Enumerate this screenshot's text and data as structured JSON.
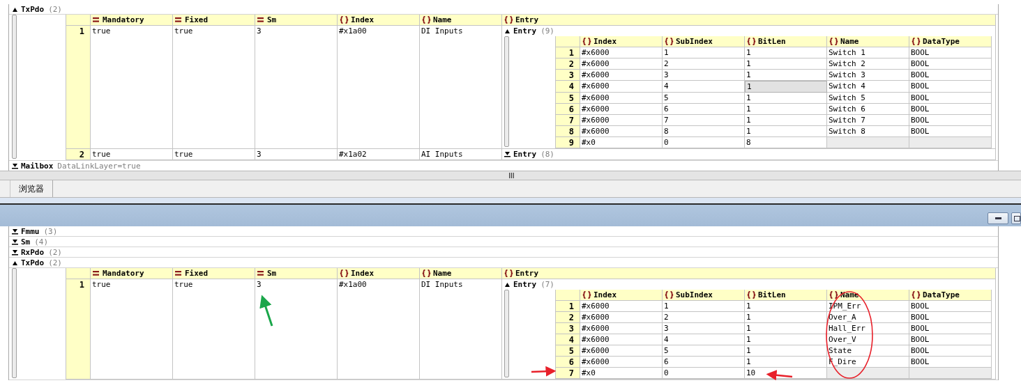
{
  "panes": [
    {
      "group": {
        "label": "TxPdo",
        "count": "(2)",
        "expanded": true
      },
      "table": {
        "columns": [
          {
            "kind": "attribute",
            "label": "Mandatory"
          },
          {
            "kind": "attribute",
            "label": "Fixed"
          },
          {
            "kind": "attribute",
            "label": "Sm"
          },
          {
            "kind": "element",
            "label": "Index"
          },
          {
            "kind": "element",
            "label": "Name"
          },
          {
            "kind": "element",
            "label": "Entry"
          }
        ],
        "rows": [
          {
            "num": "1",
            "cells": [
              "true",
              "true",
              "3",
              "#x1a00",
              "DI Inputs"
            ],
            "entry": {
              "label": "Entry",
              "count": "(9)",
              "expanded": true,
              "columns": [
                {
                  "kind": "element",
                  "label": "Index"
                },
                {
                  "kind": "element",
                  "label": "SubIndex"
                },
                {
                  "kind": "element",
                  "label": "BitLen"
                },
                {
                  "kind": "element",
                  "label": "Name"
                },
                {
                  "kind": "element",
                  "label": "DataType"
                }
              ],
              "rows": [
                {
                  "num": "1",
                  "cells": [
                    {
                      "text": "#x6000",
                      "selected": false
                    },
                    {
                      "text": "1",
                      "selected": false
                    },
                    {
                      "text": "1",
                      "selected": false
                    },
                    {
                      "text": "Switch 1",
                      "selected": false
                    },
                    {
                      "text": "BOOL",
                      "selected": false
                    }
                  ]
                },
                {
                  "num": "2",
                  "cells": [
                    {
                      "text": "#x6000",
                      "selected": false
                    },
                    {
                      "text": "2",
                      "selected": false
                    },
                    {
                      "text": "1",
                      "selected": false
                    },
                    {
                      "text": "Switch 2",
                      "selected": false
                    },
                    {
                      "text": "BOOL",
                      "selected": false
                    }
                  ]
                },
                {
                  "num": "3",
                  "cells": [
                    {
                      "text": "#x6000",
                      "selected": false
                    },
                    {
                      "text": "3",
                      "selected": false
                    },
                    {
                      "text": "1",
                      "selected": false
                    },
                    {
                      "text": "Switch 3",
                      "selected": false
                    },
                    {
                      "text": "BOOL",
                      "selected": false
                    }
                  ]
                },
                {
                  "num": "4",
                  "cells": [
                    {
                      "text": "#x6000",
                      "selected": false
                    },
                    {
                      "text": "4",
                      "selected": false
                    },
                    {
                      "text": "1",
                      "selected": true
                    },
                    {
                      "text": "Switch 4",
                      "selected": false
                    },
                    {
                      "text": "BOOL",
                      "selected": false
                    }
                  ]
                },
                {
                  "num": "5",
                  "cells": [
                    {
                      "text": "#x6000",
                      "selected": false
                    },
                    {
                      "text": "5",
                      "selected": false
                    },
                    {
                      "text": "1",
                      "selected": false
                    },
                    {
                      "text": "Switch 5",
                      "selected": false
                    },
                    {
                      "text": "BOOL",
                      "selected": false
                    }
                  ]
                },
                {
                  "num": "6",
                  "cells": [
                    {
                      "text": "#x6000",
                      "selected": false
                    },
                    {
                      "text": "6",
                      "selected": false
                    },
                    {
                      "text": "1",
                      "selected": false
                    },
                    {
                      "text": "Switch 6",
                      "selected": false
                    },
                    {
                      "text": "BOOL",
                      "selected": false
                    }
                  ]
                },
                {
                  "num": "7",
                  "cells": [
                    {
                      "text": "#x6000",
                      "selected": false
                    },
                    {
                      "text": "7",
                      "selected": false
                    },
                    {
                      "text": "1",
                      "selected": false
                    },
                    {
                      "text": "Switch 7",
                      "selected": false
                    },
                    {
                      "text": "BOOL",
                      "selected": false
                    }
                  ]
                },
                {
                  "num": "8",
                  "cells": [
                    {
                      "text": "#x6000",
                      "selected": false
                    },
                    {
                      "text": "8",
                      "selected": false
                    },
                    {
                      "text": "1",
                      "selected": false
                    },
                    {
                      "text": "Switch 8",
                      "selected": false
                    },
                    {
                      "text": "BOOL",
                      "selected": false
                    }
                  ]
                },
                {
                  "num": "9",
                  "cells": [
                    {
                      "text": "#x0",
                      "selected": false
                    },
                    {
                      "text": "0",
                      "selected": false
                    },
                    {
                      "text": "8",
                      "selected": false
                    }
                  ]
                }
              ]
            }
          },
          {
            "num": "2",
            "cells": [
              "true",
              "true",
              "3",
              "#x1a02",
              "AI Inputs"
            ],
            "entry": {
              "label": "Entry",
              "count": "(8)",
              "expanded": false
            }
          }
        ]
      },
      "after": [
        {
          "label": "Mailbox",
          "text": "DataLinkLayer=true",
          "expanded": false
        }
      ]
    },
    {
      "before": [
        {
          "label": "Fmmu",
          "count": "(3)",
          "expanded": false
        },
        {
          "label": "Sm",
          "count": "(4)",
          "expanded": false
        },
        {
          "label": "RxPdo",
          "count": "(2)",
          "expanded": false
        }
      ],
      "group": {
        "label": "TxPdo",
        "count": "(2)",
        "expanded": true
      },
      "table": {
        "columns": [
          {
            "kind": "attribute",
            "label": "Mandatory"
          },
          {
            "kind": "attribute",
            "label": "Fixed"
          },
          {
            "kind": "attribute",
            "label": "Sm"
          },
          {
            "kind": "element",
            "label": "Index"
          },
          {
            "kind": "element",
            "label": "Name"
          },
          {
            "kind": "element",
            "label": "Entry"
          }
        ],
        "rows": [
          {
            "num": "1",
            "cells": [
              "true",
              "true",
              "3",
              "#x1a00",
              "DI Inputs"
            ],
            "entry": {
              "label": "Entry",
              "count": "(7)",
              "expanded": true,
              "columns": [
                {
                  "kind": "element",
                  "label": "Index"
                },
                {
                  "kind": "element",
                  "label": "SubIndex"
                },
                {
                  "kind": "element",
                  "label": "BitLen"
                },
                {
                  "kind": "element",
                  "label": "Name"
                },
                {
                  "kind": "element",
                  "label": "DataType"
                }
              ],
              "rows": [
                {
                  "num": "1",
                  "cells": [
                    {
                      "text": "#x6000",
                      "selected": false
                    },
                    {
                      "text": "1",
                      "selected": false
                    },
                    {
                      "text": "1",
                      "selected": false
                    },
                    {
                      "text": "IPM_Err",
                      "selected": false
                    },
                    {
                      "text": "BOOL",
                      "selected": false
                    }
                  ]
                },
                {
                  "num": "2",
                  "cells": [
                    {
                      "text": "#x6000",
                      "selected": false
                    },
                    {
                      "text": "2",
                      "selected": false
                    },
                    {
                      "text": "1",
                      "selected": false
                    },
                    {
                      "text": "Over_A",
                      "selected": false
                    },
                    {
                      "text": "BOOL",
                      "selected": false
                    }
                  ]
                },
                {
                  "num": "3",
                  "cells": [
                    {
                      "text": "#x6000",
                      "selected": false
                    },
                    {
                      "text": "3",
                      "selected": false
                    },
                    {
                      "text": "1",
                      "selected": false
                    },
                    {
                      "text": "Hall_Err",
                      "selected": false
                    },
                    {
                      "text": "BOOL",
                      "selected": false
                    }
                  ]
                },
                {
                  "num": "4",
                  "cells": [
                    {
                      "text": "#x6000",
                      "selected": false
                    },
                    {
                      "text": "4",
                      "selected": false
                    },
                    {
                      "text": "1",
                      "selected": false
                    },
                    {
                      "text": "Over_V",
                      "selected": false
                    },
                    {
                      "text": "BOOL",
                      "selected": false
                    }
                  ]
                },
                {
                  "num": "5",
                  "cells": [
                    {
                      "text": "#x6000",
                      "selected": false
                    },
                    {
                      "text": "5",
                      "selected": false
                    },
                    {
                      "text": "1",
                      "selected": false
                    },
                    {
                      "text": "State",
                      "selected": false
                    },
                    {
                      "text": "BOOL",
                      "selected": false
                    }
                  ]
                },
                {
                  "num": "6",
                  "cells": [
                    {
                      "text": "#x6000",
                      "selected": false
                    },
                    {
                      "text": "6",
                      "selected": false
                    },
                    {
                      "text": "1",
                      "selected": false
                    },
                    {
                      "text": "F_Dire",
                      "selected": false
                    },
                    {
                      "text": "BOOL",
                      "selected": false
                    }
                  ]
                },
                {
                  "num": "7",
                  "cells": [
                    {
                      "text": "#x0",
                      "selected": false
                    },
                    {
                      "text": "0",
                      "selected": false
                    },
                    {
                      "text": "10",
                      "selected": false
                    }
                  ]
                }
              ]
            }
          }
        ]
      }
    }
  ],
  "tabs": [
    {
      "label": "浏览器",
      "selected": true
    }
  ]
}
